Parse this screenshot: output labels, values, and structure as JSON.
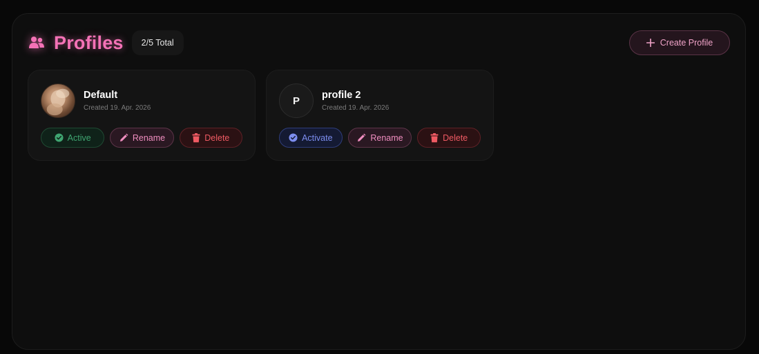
{
  "header": {
    "title": "Profiles",
    "title_icon": "users-icon",
    "count_badge": "2/5 Total",
    "create_button": {
      "label": "Create Profile",
      "icon": "plus-icon"
    }
  },
  "profiles": [
    {
      "name": "Default",
      "created": "Created 19. Apr. 2026",
      "avatar": "photo",
      "status_button": {
        "label": "Active",
        "icon": "check-circle-icon"
      },
      "rename_button": {
        "label": "Rename",
        "icon": "pencil-icon"
      },
      "delete_button": {
        "label": "Delete",
        "icon": "trash-icon"
      }
    },
    {
      "name": "profile 2",
      "created": "Created 19. Apr. 2026",
      "avatar_letter": "P",
      "status_button": {
        "label": "Activate",
        "icon": "check-circle-icon"
      },
      "rename_button": {
        "label": "Rename",
        "icon": "pencil-icon"
      },
      "delete_button": {
        "label": "Delete",
        "icon": "trash-icon"
      }
    }
  ],
  "colors": {
    "accent_pink": "#f472b6",
    "active_green": "#3fa571",
    "activate_blue": "#7d8ef0",
    "delete_red": "#f05a63",
    "background": "#0e0e0e"
  }
}
